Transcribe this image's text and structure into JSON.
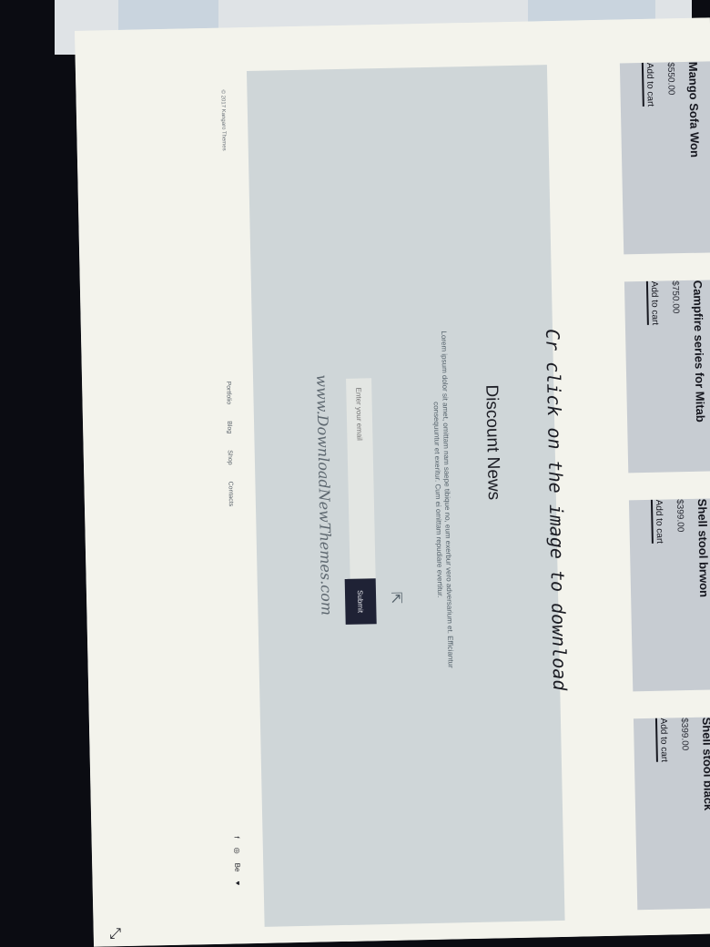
{
  "products": [
    {
      "name": "Mango Sofa Won",
      "price": "$550.00",
      "cta": "Add to cart"
    },
    {
      "name": "Campfire series for Mitab",
      "price": "$750.00",
      "cta": "Add to cart"
    },
    {
      "name": "Shell stool brwon",
      "price": "$399.00",
      "cta": "Add to cart"
    },
    {
      "name": "Shell stool black",
      "price": "$399.00",
      "cta": "Add to cart"
    }
  ],
  "watermark": {
    "click_text": "Cr click on the image to download",
    "site_text": "www.DownloadNewThemes.com"
  },
  "newsletter": {
    "title": "Discount News",
    "text": "Lorem ipsum dolor sit amet, omittam nam saepe tibique no, eum exerbur vero adversarium et. Efficiantur consequuntur et exeritur. Cum ei omittam repudiare evertitur.",
    "email_placeholder": "Enter your email",
    "submit_label": "Submit"
  },
  "footer": {
    "copyright": "© 2017 Kangaro Themes",
    "links": [
      "Portfolio",
      "Blog",
      "Shop",
      "Contacts"
    ],
    "socials": [
      "f",
      "◎",
      "Be",
      "♥"
    ]
  }
}
